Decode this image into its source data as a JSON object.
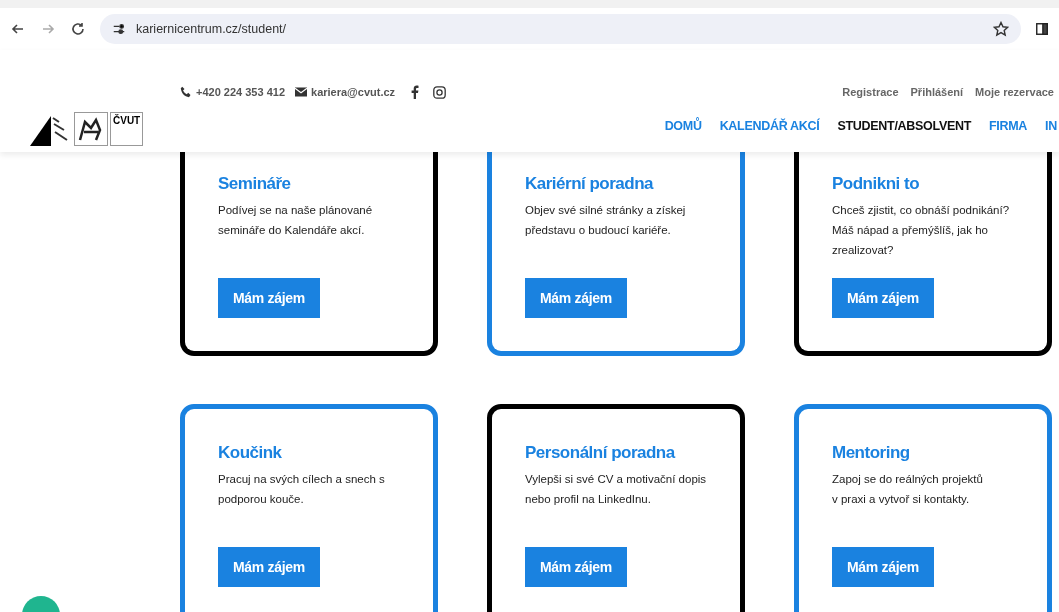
{
  "browser": {
    "url": "kariernicentrum.cz/student/"
  },
  "header": {
    "phone": "+420 224 353 412",
    "email": "kariera@cvut.cz",
    "logo_text": "ČVUT",
    "account_links": [
      "Registrace",
      "Přihlášení",
      "Moje rezervace"
    ],
    "nav": [
      {
        "label": "DOMŮ",
        "selected": false
      },
      {
        "label": "KALENDÁŘ AKCÍ",
        "selected": false
      },
      {
        "label": "STUDENT/ABSOLVENT",
        "selected": true
      },
      {
        "label": "FIRMA",
        "selected": false
      },
      {
        "label": "IN",
        "selected": false
      }
    ]
  },
  "cards": [
    {
      "title": "Semináře",
      "text": "Podívej se na naše plánované\nsemináře do Kalendáře akcí.",
      "button": "Mám zájem",
      "color": "#000000"
    },
    {
      "title": "Kariérní poradna",
      "text": "Objev své silné stránky a získej\npředstavu o budoucí kariéře.",
      "button": "Mám zájem",
      "color": "#1a82e0"
    },
    {
      "title": "Podnikni to",
      "text": "Chceš zjistit, co obnáší podnikání?\nMáš nápad a přemýšlíš, jak ho\nzrealizovat?",
      "button": "Mám zájem",
      "color": "#000000"
    },
    {
      "title": "Koučink",
      "text": "Pracuj na svých cílech a snech s\npodporou kouče.",
      "button": "Mám zájem",
      "color": "#1a82e0"
    },
    {
      "title": "Personální poradna",
      "text": "Vylepši si své CV a motivační dopis\nnebo profil na LinkedInu.",
      "button": "Mám zájem",
      "color": "#000000"
    },
    {
      "title": "Mentoring",
      "text": "Zapoj se do reálných projektů\nv praxi a vytvoř si kontakty.",
      "button": "Mám zájem",
      "color": "#1a82e0"
    }
  ]
}
